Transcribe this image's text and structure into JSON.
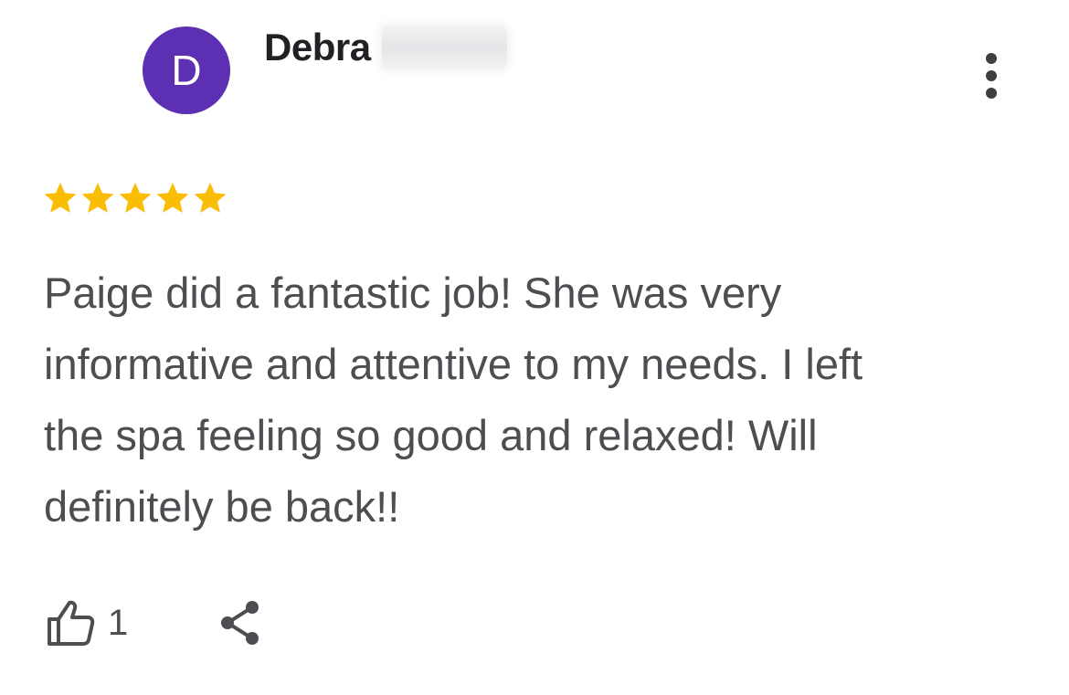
{
  "review": {
    "author": {
      "initial": "D",
      "first_name": "Debra",
      "avatar_color": "#5d2fb2"
    },
    "rating": 5,
    "rating_max": 5,
    "star_color": "#fbbc04",
    "text": "Paige did a fantastic job! She was very\ninformative and attentive to my needs. I left\nthe spa feeling so good and relaxed! Will\ndefinitely be back!!",
    "likes": "1"
  },
  "icons": {
    "more": "more-vert-icon",
    "like": "thumb-up-icon",
    "share": "share-icon",
    "star": "star-icon"
  }
}
